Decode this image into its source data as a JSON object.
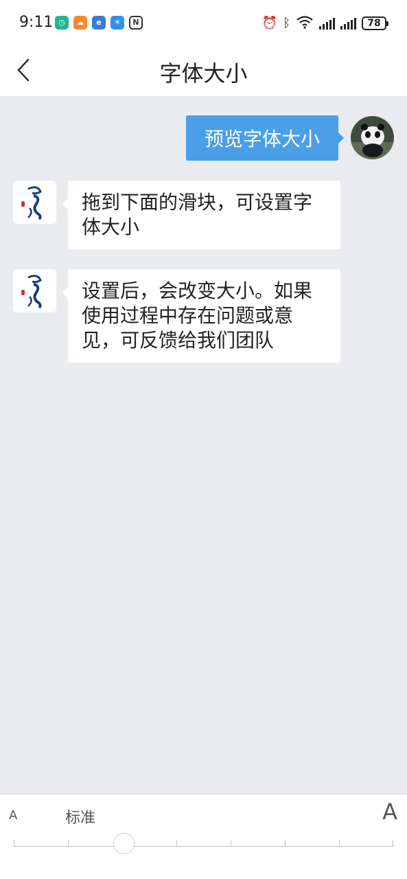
{
  "status_bar": {
    "time": "9:11",
    "battery": "78",
    "notif_icons": [
      {
        "name": "xiaomi-app-icon",
        "glyph": "◷",
        "color": "#20b58a"
      },
      {
        "name": "chat-app-icon",
        "glyph": "☁",
        "color": "#f28a2e"
      },
      {
        "name": "game-app-icon",
        "glyph": "e",
        "color": "#3a7bd5"
      },
      {
        "name": "weather-app-icon",
        "glyph": "☀",
        "color": "#2f8ff0"
      },
      {
        "name": "nfc-icon",
        "glyph": "N",
        "color": "#333333"
      }
    ]
  },
  "nav": {
    "title": "字体大小"
  },
  "chat": {
    "user_message": "预览字体大小",
    "bot_messages": [
      "拖到下面的滑块，可设置字体大小",
      "设置后，会改变大小。如果使用过程中存在问题或意见，可反馈给我们团队"
    ]
  },
  "font_slider": {
    "small_label": "A",
    "large_label": "A",
    "current_label": "标准",
    "selected_step": 2,
    "step_count": 8
  },
  "colors": {
    "accent": "#4a9fe8",
    "background": "#e9ebef",
    "bubble": "#ffffff"
  }
}
